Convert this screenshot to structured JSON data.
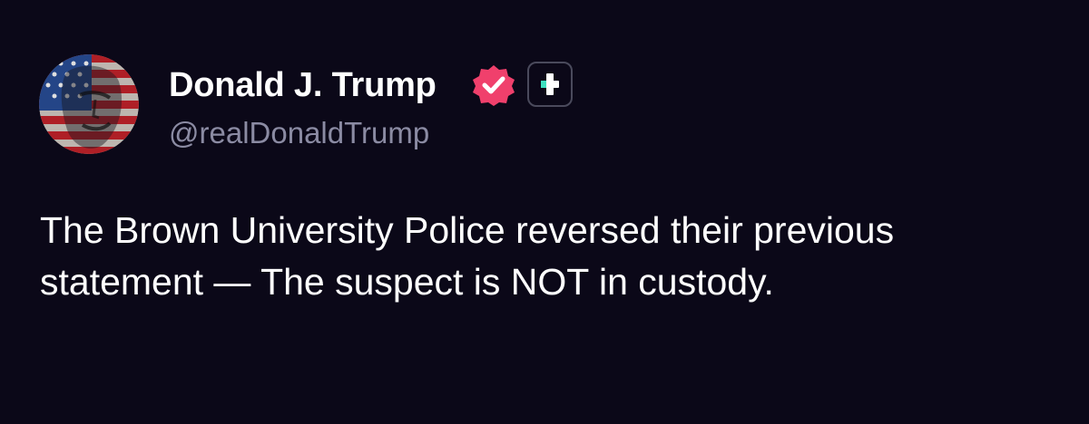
{
  "author": {
    "display_name": "Donald J. Trump",
    "handle": "@realDonaldTrump",
    "avatar_icon": "flag-portrait-avatar",
    "verified_icon": "verified-badge-icon",
    "plus_icon": "plus-badge-icon"
  },
  "post": {
    "text": "The Brown University Police reversed their previous statement — The suspect is NOT in custody."
  },
  "colors": {
    "background": "#0b0818",
    "text": "#ffffff",
    "handle": "#8b8ba3",
    "verified": "#f0406c",
    "plus_accent": "#3ee0c0"
  }
}
